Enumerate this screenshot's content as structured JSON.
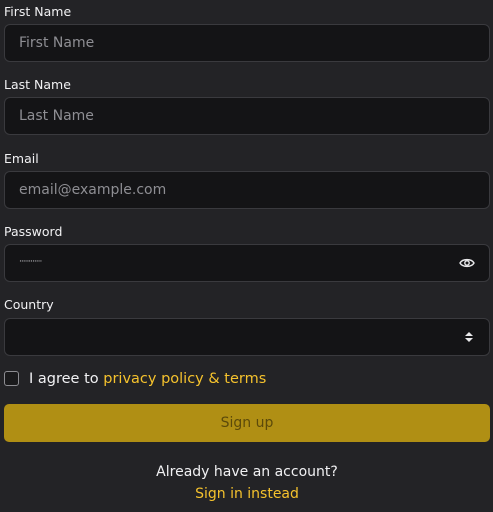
{
  "form": {
    "first_name": {
      "label": "First Name",
      "placeholder": "First Name",
      "value": ""
    },
    "last_name": {
      "label": "Last Name",
      "placeholder": "Last Name",
      "value": ""
    },
    "email": {
      "label": "Email",
      "placeholder": "email@example.com",
      "value": ""
    },
    "password": {
      "label": "Password",
      "masked_value": "············"
    },
    "country": {
      "label": "Country",
      "value": ""
    },
    "agree": {
      "prefix": "I agree to",
      "link": "privacy policy & terms",
      "checked": false
    },
    "signup_label": "Sign up",
    "already_text": "Already have an account?",
    "signin_link": "Sign in instead"
  },
  "icons": {
    "password_toggle": "eye-icon",
    "country_select": "sort-arrows-icon"
  },
  "colors": {
    "background": "#232326",
    "field_bg": "#141416",
    "accent": "#f5c22d",
    "button_bg": "#b08f14"
  }
}
